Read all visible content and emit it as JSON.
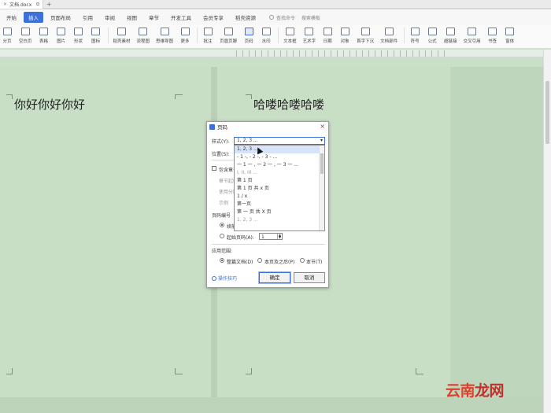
{
  "titlebar": {
    "doc_name": "文档.docx",
    "add_tab": "+"
  },
  "menu": {
    "items": [
      "开始",
      "插入",
      "页面布局",
      "引用",
      "审阅",
      "视图",
      "章节",
      "开发工具",
      "会员专享",
      "稻壳资源"
    ],
    "active": "插入",
    "search_label": "查找命令",
    "search_template": "搜索模板"
  },
  "toolbar": {
    "items": [
      "分页",
      "空白页",
      "表格",
      "图片",
      "形状",
      "图标",
      "稻壳素材",
      "流程图",
      "思维导图",
      "更多",
      "批注",
      "页眉页脚",
      "页码",
      "水印",
      "文本框",
      "艺术字",
      "日期",
      "对象",
      "首字下沉",
      "文档部件",
      "符号",
      "公式",
      "超链接",
      "交叉引用",
      "书签",
      "窗体"
    ],
    "selected": "页码"
  },
  "pages": {
    "left_text": "你好你好你好",
    "right_text": "哈喽哈喽哈喽"
  },
  "dialog": {
    "title": "页码",
    "style_label": "样式(Y):",
    "style_value": "1, 2, 3 ...",
    "position_label": "位置(S):",
    "include_chapter": "包含章节号",
    "chapter_start": "章节起始样式",
    "separator": "使用分隔符",
    "example": "示例",
    "numbering_label": "页码编号",
    "continue_prev": "续前节",
    "start_at": "起始页码(A):",
    "start_value": "1",
    "apply_label": "应用范围:",
    "apply_whole": "整篇文档(D)",
    "apply_after": "本页及之后(P)",
    "apply_section": "本节(T)",
    "tips": "操作技巧",
    "ok": "确定",
    "cancel": "取消",
    "options": [
      "1, 2, 3 ...",
      "- 1 -, - 2 -, - 3 - ...",
      "一 1 一 , 一 2 一 , 一 3 一 ...",
      "I, II, III ...",
      "第 1 页",
      "第 1 页 共 x 页",
      "1 / x",
      "第一页",
      "第 一 页 共 X 页",
      "1, 2, 3 ..."
    ]
  },
  "watermark": {
    "part1": "云南",
    "part2": "龙网"
  }
}
